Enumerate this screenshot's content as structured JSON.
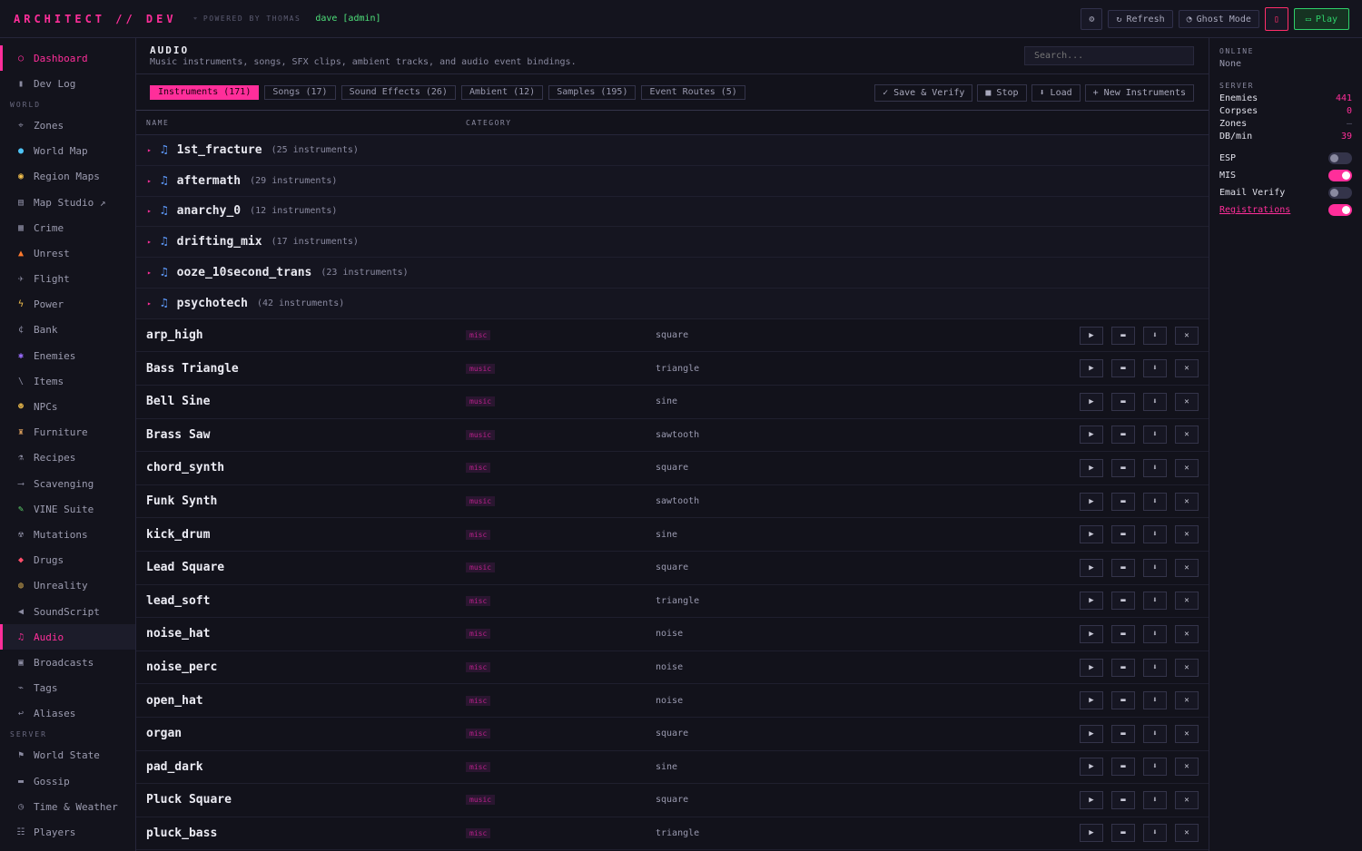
{
  "header": {
    "brand": "ARCHITECT // DEV",
    "powered": "POWERED BY THOMAS",
    "user": "dave [admin]",
    "refresh_label": "Refresh",
    "ghost_label": "Ghost Mode",
    "play_label": "Play"
  },
  "sidebar": {
    "top_items": [
      {
        "label": "Dashboard",
        "icon": "circle-icon"
      },
      {
        "label": "Dev Log",
        "icon": "notebook-icon"
      }
    ],
    "world_heading": "WORLD",
    "world_items": [
      {
        "label": "Zones",
        "icon": "zones-icon"
      },
      {
        "label": "World Map",
        "icon": "globe-icon"
      },
      {
        "label": "Region Maps",
        "icon": "region-icon"
      },
      {
        "label": "Map Studio ↗",
        "icon": "map-studio-icon"
      },
      {
        "label": "Crime",
        "icon": "crime-icon"
      },
      {
        "label": "Unrest",
        "icon": "fire-icon"
      },
      {
        "label": "Flight",
        "icon": "plane-icon"
      },
      {
        "label": "Power",
        "icon": "bolt-icon"
      },
      {
        "label": "Bank",
        "icon": "currency-icon"
      },
      {
        "label": "Enemies",
        "icon": "enemy-icon"
      },
      {
        "label": "Items",
        "icon": "item-icon"
      },
      {
        "label": "NPCs",
        "icon": "npc-icon"
      },
      {
        "label": "Furniture",
        "icon": "furniture-icon"
      },
      {
        "label": "Recipes",
        "icon": "recipe-icon"
      },
      {
        "label": "Scavenging",
        "icon": "scavenge-icon"
      },
      {
        "label": "VINE Suite",
        "icon": "vine-icon"
      },
      {
        "label": "Mutations",
        "icon": "mutation-icon"
      },
      {
        "label": "Drugs",
        "icon": "pill-icon"
      },
      {
        "label": "Unreality",
        "icon": "unreality-icon"
      },
      {
        "label": "SoundScript",
        "icon": "speaker-icon"
      },
      {
        "label": "Audio",
        "icon": "music-icon",
        "active": true
      },
      {
        "label": "Broadcasts",
        "icon": "radio-icon"
      },
      {
        "label": "Tags",
        "icon": "tag-icon"
      },
      {
        "label": "Aliases",
        "icon": "alias-icon"
      }
    ],
    "server_heading": "SERVER",
    "server_items": [
      {
        "label": "World State",
        "icon": "flag-icon"
      },
      {
        "label": "Gossip",
        "icon": "chat-icon"
      },
      {
        "label": "Time & Weather",
        "icon": "clock-icon"
      },
      {
        "label": "Players",
        "icon": "players-icon"
      }
    ]
  },
  "main": {
    "title": "AUDIO",
    "subtitle": "Music instruments, songs, SFX clips, ambient tracks, and audio event bindings.",
    "search_placeholder": "Search...",
    "tabs": [
      {
        "label": "Instruments (171)",
        "active": true
      },
      {
        "label": "Songs (17)"
      },
      {
        "label": "Sound Effects (26)"
      },
      {
        "label": "Ambient (12)"
      },
      {
        "label": "Samples (195)"
      },
      {
        "label": "Event Routes (5)"
      }
    ],
    "actions": {
      "save": "✓ Save & Verify",
      "stop": "■ Stop",
      "load": "⬇ Load",
      "new": "+ New Instruments"
    },
    "columns": {
      "name": "NAME",
      "category": "CATEGORY"
    },
    "groups": [
      {
        "name": "1st_fracture",
        "count": "(25 instruments)"
      },
      {
        "name": "aftermath",
        "count": "(29 instruments)"
      },
      {
        "name": "anarchy_0",
        "count": "(12 instruments)"
      },
      {
        "name": "drifting_mix",
        "count": "(17 instruments)"
      },
      {
        "name": "ooze_10second_trans",
        "count": "(23 instruments)"
      },
      {
        "name": "psychotech",
        "count": "(42 instruments)"
      }
    ],
    "rows": [
      {
        "name": "arp_high",
        "category": "misc",
        "wave": "square"
      },
      {
        "name": "Bass Triangle",
        "category": "music",
        "wave": "triangle"
      },
      {
        "name": "Bell Sine",
        "category": "music",
        "wave": "sine"
      },
      {
        "name": "Brass Saw",
        "category": "music",
        "wave": "sawtooth"
      },
      {
        "name": "chord_synth",
        "category": "misc",
        "wave": "square"
      },
      {
        "name": "Funk Synth",
        "category": "music",
        "wave": "sawtooth"
      },
      {
        "name": "kick_drum",
        "category": "misc",
        "wave": "sine"
      },
      {
        "name": "Lead Square",
        "category": "music",
        "wave": "square"
      },
      {
        "name": "lead_soft",
        "category": "misc",
        "wave": "triangle"
      },
      {
        "name": "noise_hat",
        "category": "misc",
        "wave": "noise"
      },
      {
        "name": "noise_perc",
        "category": "misc",
        "wave": "noise"
      },
      {
        "name": "open_hat",
        "category": "misc",
        "wave": "noise"
      },
      {
        "name": "organ",
        "category": "misc",
        "wave": "square"
      },
      {
        "name": "pad_dark",
        "category": "misc",
        "wave": "sine"
      },
      {
        "name": "Pluck Square",
        "category": "music",
        "wave": "square"
      },
      {
        "name": "pluck_bass",
        "category": "misc",
        "wave": "triangle"
      }
    ]
  },
  "panel": {
    "online_heading": "ONLINE",
    "online_value": "None",
    "server_heading": "SERVER",
    "stats": [
      {
        "label": "Enemies",
        "value": "441"
      },
      {
        "label": "Corpses",
        "value": "0"
      },
      {
        "label": "Zones",
        "value": "—"
      },
      {
        "label": "DB/min",
        "value": "39"
      }
    ],
    "toggles": [
      {
        "label": "ESP",
        "on": false
      },
      {
        "label": "MIS",
        "on": true
      },
      {
        "label": "Email Verify",
        "on": false
      },
      {
        "label": "Registrations",
        "on": true,
        "link": true
      }
    ]
  },
  "colors": {
    "accent": "#ff2e9a",
    "play": "#2fd06a",
    "background": "#12121b"
  }
}
